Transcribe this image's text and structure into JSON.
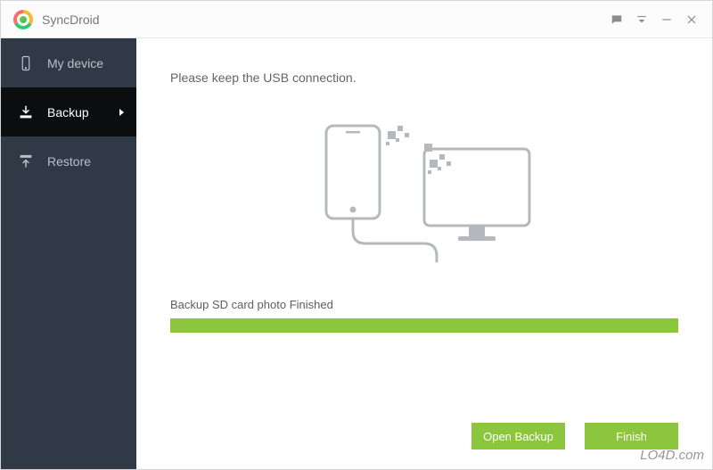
{
  "app": {
    "title": "SyncDroid"
  },
  "sidebar": {
    "items": [
      {
        "label": "My device"
      },
      {
        "label": "Backup"
      },
      {
        "label": "Restore"
      }
    ]
  },
  "main": {
    "instruction": "Please keep the USB connection.",
    "status": "Backup SD card photo Finished",
    "progress_percent": 100
  },
  "actions": {
    "open_backup": "Open Backup",
    "finish": "Finish"
  },
  "watermark": "LO4D.com"
}
